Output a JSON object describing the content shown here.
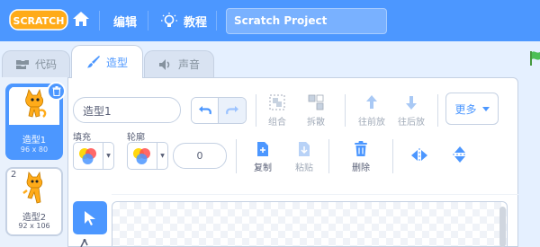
{
  "menubar": {
    "logo_text": "SCRATCH",
    "edit_label": "编辑",
    "tutorials_label": "教程",
    "project_title": "Scratch Project"
  },
  "tabs": [
    {
      "label": "代码",
      "icon": "code-blocks-icon"
    },
    {
      "label": "造型",
      "icon": "paintbrush-icon"
    },
    {
      "label": "声音",
      "icon": "speaker-icon"
    }
  ],
  "costumes": [
    {
      "number": "1",
      "name": "造型1",
      "size": "96 x 80"
    },
    {
      "number": "2",
      "name": "造型2",
      "size": "92 x 106"
    }
  ],
  "editor": {
    "costume_name": "造型1",
    "group_label": "组合",
    "ungroup_label": "拆散",
    "forward_label": "往前放",
    "backward_label": "往后放",
    "more_label": "更多",
    "fill_label": "填充",
    "outline_label": "轮廓",
    "outline_width": "0",
    "copy_label": "复制",
    "paste_label": "粘贴",
    "delete_label": "删除"
  },
  "colors": {
    "accent": "#4c97ff",
    "menubar": "#4c97ff",
    "logo": "#ffab19",
    "green_flag": "#4cbf56",
    "delete_red": "#d94a4a"
  }
}
